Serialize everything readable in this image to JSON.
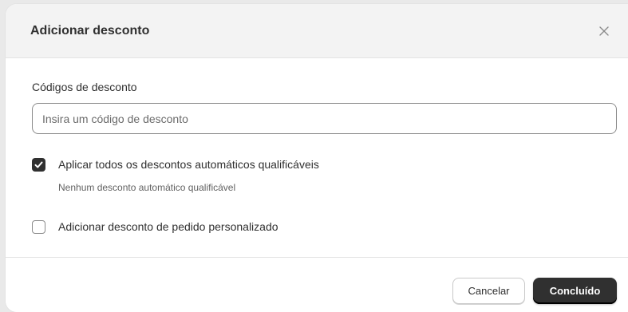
{
  "modal": {
    "title": "Adicionar desconto",
    "close_icon": "close-icon"
  },
  "discount_codes": {
    "label": "Códigos de desconto",
    "input_value": "",
    "placeholder": "Insira um código de desconto"
  },
  "auto_discounts": {
    "checked": true,
    "label": "Aplicar todos os descontos automáticos qualificáveis",
    "help_text": "Nenhum desconto automático qualificável"
  },
  "custom_discount": {
    "checked": false,
    "label": "Adicionar desconto de pedido personalizado"
  },
  "footer": {
    "cancel_label": "Cancelar",
    "done_label": "Concluído"
  },
  "colors": {
    "primary_button": "#303030",
    "header_bg": "#f3f3f3",
    "border": "#8a8a8a"
  }
}
